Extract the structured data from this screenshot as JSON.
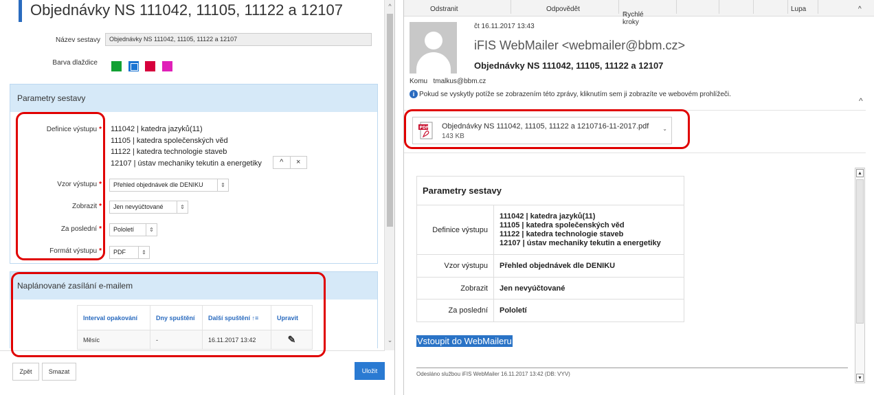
{
  "left": {
    "title": "Objednávky NS 111042, 11105, 11122 a 12107",
    "name_label": "Název sestavy",
    "name_value": "Objednávky NS 111042, 11105, 11122 a 12107",
    "color_label": "Barva dlaždice",
    "colors": [
      "#12a133",
      "#1a74d2",
      "#d6003c",
      "#e020b8"
    ],
    "params_header": "Parametry sestavy",
    "def_label": "Definice výstupu",
    "definitions": [
      "111042 | katedra jazyků(11)",
      "11105 | katedra společenských věd",
      "11122 | katedra technologie staveb",
      "12107 | ústav mechaniky tekutin a energetiky"
    ],
    "up_icon": "^",
    "close_icon": "×",
    "vzor_label": "Vzor výstupu",
    "vzor_value": "Přehled objednávek dle DENIKU",
    "zobrazit_label": "Zobrazit",
    "zobrazit_value": "Jen nevyúčtované",
    "za_label": "Za poslední",
    "za_value": "Pololetí",
    "format_label": "Formát výstupu",
    "format_value": "PDF",
    "required_mark": "*",
    "email_header": "Naplánované zasílání e-mailem",
    "sched_cols": [
      "Interval opakování",
      "Dny spuštění",
      "Další spuštění ↑≡",
      "Upravit"
    ],
    "sched_row": [
      "Měsíc",
      "-",
      "16.11.2017 13:42"
    ],
    "btn_back": "Zpět",
    "btn_delete": "Smazat",
    "btn_save": "Uložit"
  },
  "right": {
    "ribbon": [
      "Odstranit",
      "Odpovědět",
      "Rychlé kroky",
      "Lupa"
    ],
    "date": "čt 16.11.2017 13:43",
    "from": "iFIS WebMailer <webmailer@bbm.cz>",
    "subject": "Objednávky NS 111042, 11105, 11122 a 12107",
    "to_label": "Komu",
    "to_value": "tmalkus@bbm.cz",
    "info": "Pokud se vyskytly potíže se zobrazením této zprávy, kliknutím sem ji zobrazíte ve webovém prohlížeči.",
    "attach_name": "Objednávky NS 111042, 11105, 11122 a 1210716-11-2017.pdf",
    "attach_size": "143 KB",
    "pdf_label": "PDF",
    "table_title": "Parametry sestavy",
    "def_label": "Definice výstupu",
    "definitions": [
      "111042 | katedra jazyků(11)",
      "11105 | katedra společenských věd",
      "11122 | katedra technologie staveb",
      "12107 | ústav mechaniky tekutin a energetiky"
    ],
    "vzor_label": "Vzor výstupu",
    "vzor_value": "Přehled objednávek dle DENIKU",
    "zobrazit_label": "Zobrazit",
    "zobrazit_value": "Jen nevyúčtované",
    "za_label": "Za poslední",
    "za_value": "Pololetí",
    "link": "Vstoupit do WebMaileru",
    "footer": "Odesláno službou iFIS WebMailer 16.11.2017 13:42 (DB: VYV)"
  },
  "icons": {
    "chevron_up": "^",
    "chevron_down": "⌄",
    "edit": "✎",
    "caret": "⌄"
  }
}
